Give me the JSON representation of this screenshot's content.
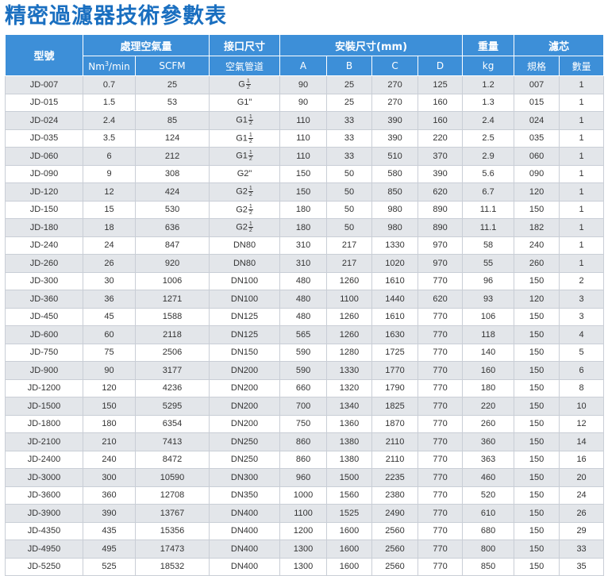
{
  "title": "精密過濾器技術參數表",
  "header": {
    "model": "型號",
    "flow_group": "處理空氣量",
    "port_group": "接口尺寸",
    "dims_group": "安裝尺寸(mm)",
    "weight_group": "重量",
    "cartridge_group": "濾芯",
    "nm3_base": "Nm",
    "nm3_sup": "3",
    "nm3_tail": "/min",
    "scfm": "SCFM",
    "pipe": "空氣管道",
    "dim_a": "A",
    "dim_b": "B",
    "dim_c": "C",
    "dim_d": "D",
    "kg": "kg",
    "spec": "規格",
    "qty": "數量"
  },
  "rows": [
    {
      "model": "JD-007",
      "nm3": "0.7",
      "scfm": "25",
      "port": "G",
      "port_num": "1",
      "port_den": "2",
      "a": "90",
      "b": "25",
      "c": "270",
      "d": "125",
      "kg": "1.2",
      "spec": "007",
      "qty": "1"
    },
    {
      "model": "JD-015",
      "nm3": "1.5",
      "scfm": "53",
      "port": "G1\"",
      "a": "90",
      "b": "25",
      "c": "270",
      "d": "160",
      "kg": "1.3",
      "spec": "015",
      "qty": "1"
    },
    {
      "model": "JD-024",
      "nm3": "2.4",
      "scfm": "85",
      "port": "G1",
      "port_num": "1",
      "port_den": "2",
      "a": "110",
      "b": "33",
      "c": "390",
      "d": "160",
      "kg": "2.4",
      "spec": "024",
      "qty": "1"
    },
    {
      "model": "JD-035",
      "nm3": "3.5",
      "scfm": "124",
      "port": "G1",
      "port_num": "1",
      "port_den": "2",
      "a": "110",
      "b": "33",
      "c": "390",
      "d": "220",
      "kg": "2.5",
      "spec": "035",
      "qty": "1"
    },
    {
      "model": "JD-060",
      "nm3": "6",
      "scfm": "212",
      "port": "G1",
      "port_num": "1",
      "port_den": "2",
      "a": "110",
      "b": "33",
      "c": "510",
      "d": "370",
      "kg": "2.9",
      "spec": "060",
      "qty": "1"
    },
    {
      "model": "JD-090",
      "nm3": "9",
      "scfm": "308",
      "port": "G2\"",
      "a": "150",
      "b": "50",
      "c": "580",
      "d": "390",
      "kg": "5.6",
      "spec": "090",
      "qty": "1"
    },
    {
      "model": "JD-120",
      "nm3": "12",
      "scfm": "424",
      "port": "G2",
      "port_num": "1",
      "port_den": "2",
      "a": "150",
      "b": "50",
      "c": "850",
      "d": "620",
      "kg": "6.7",
      "spec": "120",
      "qty": "1"
    },
    {
      "model": "JD-150",
      "nm3": "15",
      "scfm": "530",
      "port": "G2",
      "port_num": "1",
      "port_den": "2",
      "a": "180",
      "b": "50",
      "c": "980",
      "d": "890",
      "kg": "11.1",
      "spec": "150",
      "qty": "1"
    },
    {
      "model": "JD-180",
      "nm3": "18",
      "scfm": "636",
      "port": "G2",
      "port_num": "1",
      "port_den": "2",
      "a": "180",
      "b": "50",
      "c": "980",
      "d": "890",
      "kg": "11.1",
      "spec": "182",
      "qty": "1"
    },
    {
      "model": "JD-240",
      "nm3": "24",
      "scfm": "847",
      "port": "DN80",
      "a": "310",
      "b": "217",
      "c": "1330",
      "d": "970",
      "kg": "58",
      "spec": "240",
      "qty": "1"
    },
    {
      "model": "JD-260",
      "nm3": "26",
      "scfm": "920",
      "port": "DN80",
      "a": "310",
      "b": "217",
      "c": "1020",
      "d": "970",
      "kg": "55",
      "spec": "260",
      "qty": "1"
    },
    {
      "model": "JD-300",
      "nm3": "30",
      "scfm": "1006",
      "port": "DN100",
      "a": "480",
      "b": "1260",
      "c": "1610",
      "d": "770",
      "kg": "96",
      "spec": "150",
      "qty": "2"
    },
    {
      "model": "JD-360",
      "nm3": "36",
      "scfm": "1271",
      "port": "DN100",
      "a": "480",
      "b": "1100",
      "c": "1440",
      "d": "620",
      "kg": "93",
      "spec": "120",
      "qty": "3"
    },
    {
      "model": "JD-450",
      "nm3": "45",
      "scfm": "1588",
      "port": "DN125",
      "a": "480",
      "b": "1260",
      "c": "1610",
      "d": "770",
      "kg": "106",
      "spec": "150",
      "qty": "3"
    },
    {
      "model": "JD-600",
      "nm3": "60",
      "scfm": "2118",
      "port": "DN125",
      "a": "565",
      "b": "1260",
      "c": "1630",
      "d": "770",
      "kg": "118",
      "spec": "150",
      "qty": "4"
    },
    {
      "model": "JD-750",
      "nm3": "75",
      "scfm": "2506",
      "port": "DN150",
      "a": "590",
      "b": "1280",
      "c": "1725",
      "d": "770",
      "kg": "140",
      "spec": "150",
      "qty": "5"
    },
    {
      "model": "JD-900",
      "nm3": "90",
      "scfm": "3177",
      "port": "DN200",
      "a": "590",
      "b": "1330",
      "c": "1770",
      "d": "770",
      "kg": "160",
      "spec": "150",
      "qty": "6"
    },
    {
      "model": "JD-1200",
      "nm3": "120",
      "scfm": "4236",
      "port": "DN200",
      "a": "660",
      "b": "1320",
      "c": "1790",
      "d": "770",
      "kg": "180",
      "spec": "150",
      "qty": "8"
    },
    {
      "model": "JD-1500",
      "nm3": "150",
      "scfm": "5295",
      "port": "DN200",
      "a": "700",
      "b": "1340",
      "c": "1825",
      "d": "770",
      "kg": "220",
      "spec": "150",
      "qty": "10"
    },
    {
      "model": "JD-1800",
      "nm3": "180",
      "scfm": "6354",
      "port": "DN200",
      "a": "750",
      "b": "1360",
      "c": "1870",
      "d": "770",
      "kg": "260",
      "spec": "150",
      "qty": "12"
    },
    {
      "model": "JD-2100",
      "nm3": "210",
      "scfm": "7413",
      "port": "DN250",
      "a": "860",
      "b": "1380",
      "c": "2110",
      "d": "770",
      "kg": "360",
      "spec": "150",
      "qty": "14"
    },
    {
      "model": "JD-2400",
      "nm3": "240",
      "scfm": "8472",
      "port": "DN250",
      "a": "860",
      "b": "1380",
      "c": "2110",
      "d": "770",
      "kg": "363",
      "spec": "150",
      "qty": "16"
    },
    {
      "model": "JD-3000",
      "nm3": "300",
      "scfm": "10590",
      "port": "DN300",
      "a": "960",
      "b": "1500",
      "c": "2235",
      "d": "770",
      "kg": "460",
      "spec": "150",
      "qty": "20"
    },
    {
      "model": "JD-3600",
      "nm3": "360",
      "scfm": "12708",
      "port": "DN350",
      "a": "1000",
      "b": "1560",
      "c": "2380",
      "d": "770",
      "kg": "520",
      "spec": "150",
      "qty": "24"
    },
    {
      "model": "JD-3900",
      "nm3": "390",
      "scfm": "13767",
      "port": "DN400",
      "a": "1100",
      "b": "1525",
      "c": "2490",
      "d": "770",
      "kg": "610",
      "spec": "150",
      "qty": "26"
    },
    {
      "model": "JD-4350",
      "nm3": "435",
      "scfm": "15356",
      "port": "DN400",
      "a": "1200",
      "b": "1600",
      "c": "2560",
      "d": "770",
      "kg": "680",
      "spec": "150",
      "qty": "29"
    },
    {
      "model": "JD-4950",
      "nm3": "495",
      "scfm": "17473",
      "port": "DN400",
      "a": "1300",
      "b": "1600",
      "c": "2560",
      "d": "770",
      "kg": "800",
      "spec": "150",
      "qty": "33"
    },
    {
      "model": "JD-5250",
      "nm3": "525",
      "scfm": "18532",
      "port": "DN400",
      "a": "1300",
      "b": "1600",
      "c": "2560",
      "d": "770",
      "kg": "850",
      "spec": "150",
      "qty": "35"
    }
  ]
}
